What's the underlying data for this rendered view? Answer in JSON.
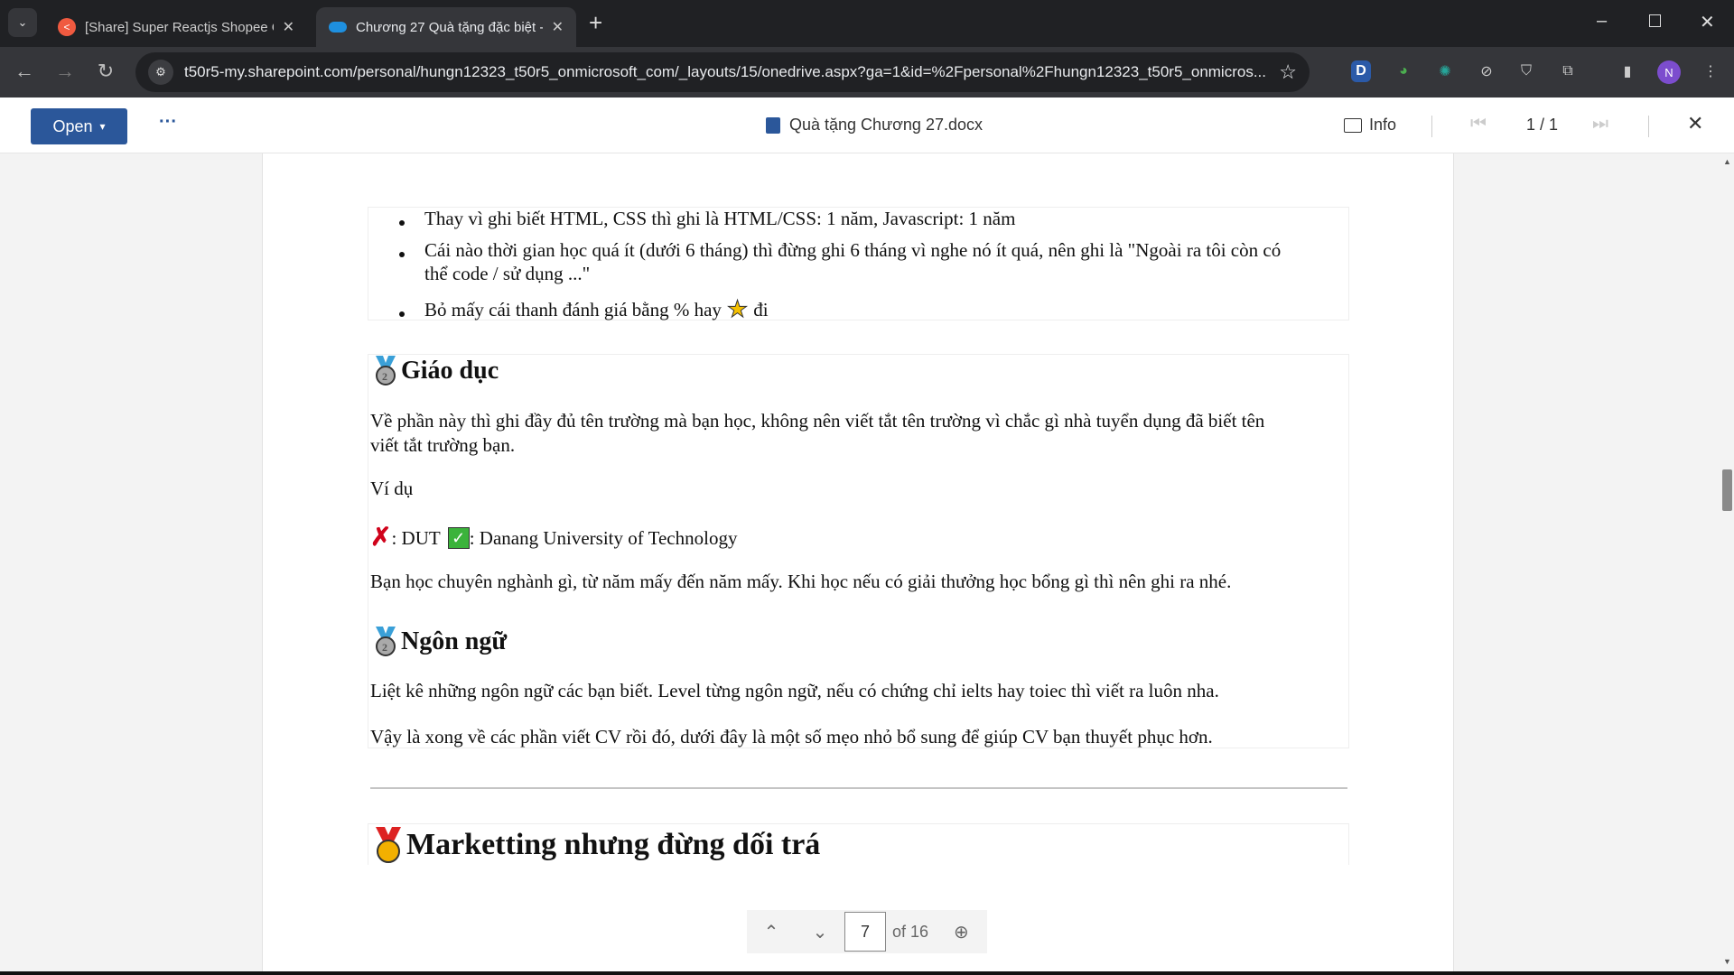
{
  "browser": {
    "tabs": [
      {
        "title": "[Share] Super Reactjs Shopee Cl",
        "active": false
      },
      {
        "title": "Chương 27 Quà tặng đặc biệt -",
        "active": true
      }
    ],
    "url": "t50r5-my.sharepoint.com/personal/hungn12323_t50r5_onmicrosoft_com/_layouts/15/onedrive.aspx?ga=1&id=%2Fpersonal%2Fhungn12323_t50r5_onmicros...",
    "profile_initial": "N",
    "ext_d": "D"
  },
  "viewer": {
    "open_label": "Open",
    "more_label": "···",
    "file_name": "Quà tặng Chương 27.docx",
    "info_label": "Info",
    "page_count": "1 / 1"
  },
  "doc": {
    "bullets": [
      "Thay vì ghi biết HTML, CSS thì ghi là HTML/CSS: 1 năm, Javascript: 1 năm",
      "Cái nào thời gian học quá ít (dưới 6 tháng) thì đừng ghi 6 tháng vì nghe nó ít quá, nên ghi là \"Ngoài ra tôi còn có",
      "thể code / sử dụng ...\"",
      "Bỏ mấy cái thanh đánh giá bằng % hay",
      "đi"
    ],
    "education": {
      "heading": "Giáo dục",
      "p1a": "Về phần này thì ghi đầy đủ tên trường mà bạn học, không nên viết tắt tên trường vì chắc gì nhà tuyển dụng đã biết tên",
      "p1b": "viết tắt trường bạn.",
      "example": "Ví dụ",
      "wrong": ": DUT",
      "right": ": Danang University of Technology",
      "p2": "Bạn học chuyên nghành gì, từ năm mấy đến năm mấy. Khi học nếu có giải thưởng học bổng gì thì nên ghi ra nhé."
    },
    "language": {
      "heading": "Ngôn ngữ",
      "p1": "Liệt kê những ngôn ngữ các bạn biết. Level từng ngôn ngữ, nếu có chứng chỉ ielts hay toiec thì viết ra luôn nha.",
      "p2": "Vậy là xong về các phần viết CV rồi đó, dưới đây là một số mẹo nhỏ bổ sung để giúp CV bạn thuyết phục hơn."
    },
    "marketing": {
      "heading": "Marketting nhưng đừng dối trá"
    }
  },
  "pagenav": {
    "current": "7",
    "total_label": "of 16"
  }
}
